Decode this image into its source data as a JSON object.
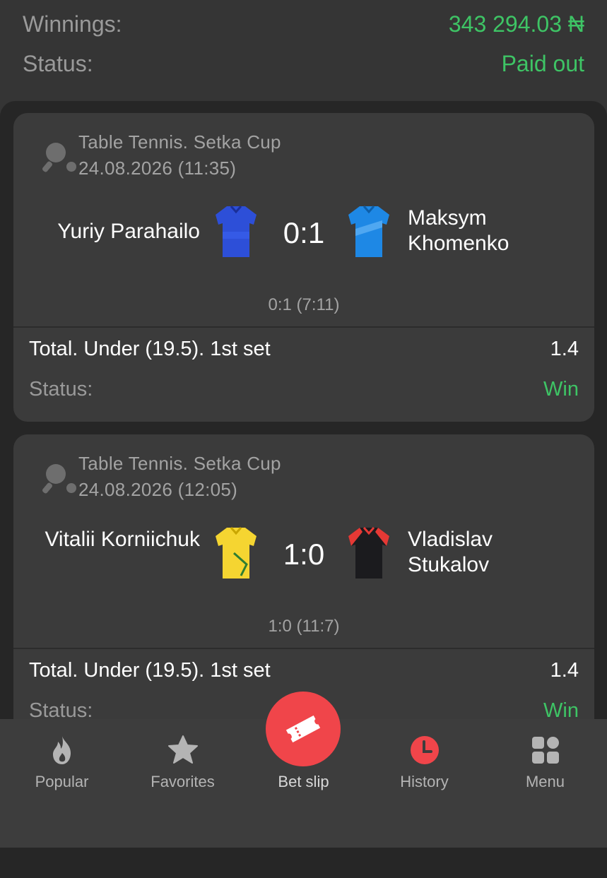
{
  "summary": {
    "winnings_label": "Winnings:",
    "winnings_value": "343 294.03 ₦",
    "status_label": "Status:",
    "status_value": "Paid out"
  },
  "bets": [
    {
      "sport_icon": "table-tennis-icon",
      "league": "Table Tennis. Setka Cup",
      "datetime": "24.08.2026 (11:35)",
      "team1": "Yuriy Parahailo",
      "team1_jersey_color": "#2d4fd8",
      "team2": "Maksym Khomenko",
      "team2_jersey_color": "#1e88e5",
      "score": "0:1",
      "subscore": "0:1 (7:11)",
      "market": "Total. Under (19.5). 1st set",
      "odds": "1.4",
      "status_label": "Status:",
      "status_value": "Win"
    },
    {
      "sport_icon": "table-tennis-icon",
      "league": "Table Tennis. Setka Cup",
      "datetime": "24.08.2026 (12:05)",
      "team1": "Vitalii Korniichuk",
      "team1_jersey_color": "#f5d531",
      "team2": "Vladislav Stukalov",
      "team2_jersey_color": "#1b1b1e",
      "score": "1:0",
      "subscore": "1:0 (11:7)",
      "market": "Total. Under (19.5). 1st set",
      "odds": "1.4",
      "status_label": "Status:",
      "status_value": "Win"
    }
  ],
  "tabbar": {
    "items": [
      {
        "label": "Popular",
        "icon": "flame-icon"
      },
      {
        "label": "Favorites",
        "icon": "star-icon"
      },
      {
        "label": "Bet slip",
        "icon": "ticket-icon"
      },
      {
        "label": "History",
        "icon": "clock-icon"
      },
      {
        "label": "Menu",
        "icon": "grid-icon"
      }
    ],
    "active": "History"
  },
  "colors": {
    "win_green": "#3ec465",
    "accent_red": "#f0454a",
    "background": "#262626",
    "card": "#3b3b3b"
  }
}
